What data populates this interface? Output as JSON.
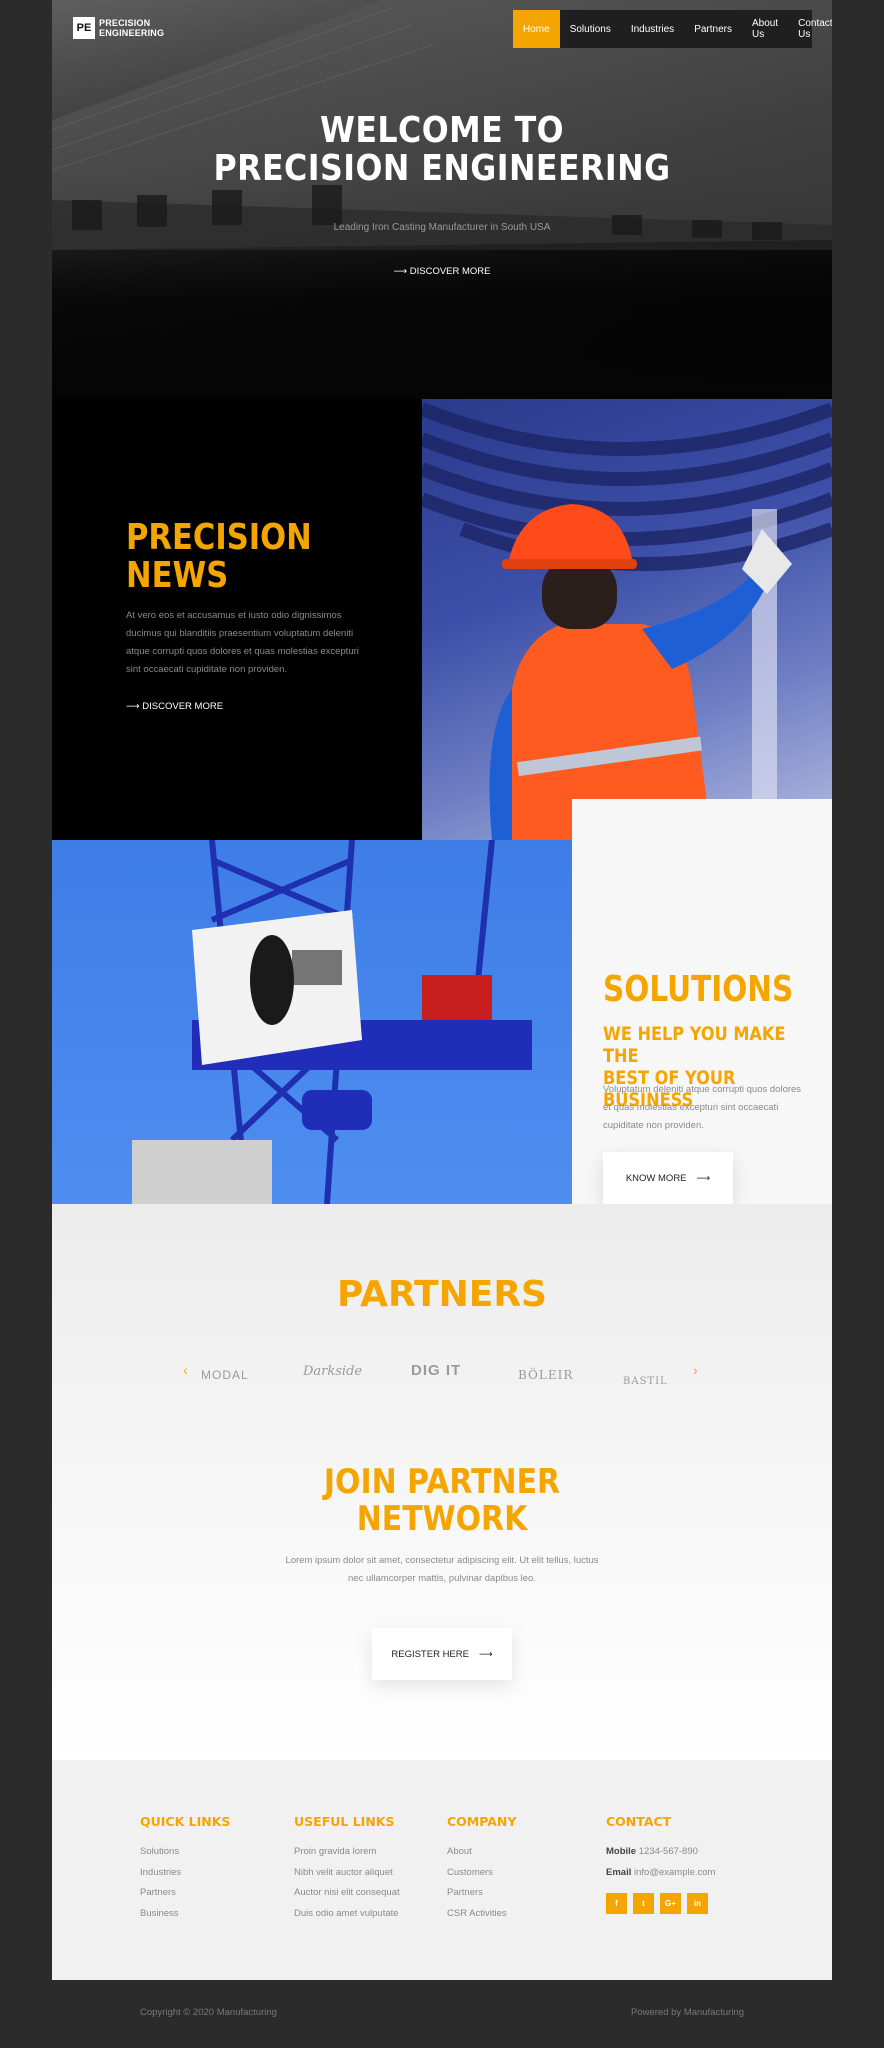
{
  "brand": {
    "logo_mark": "PE",
    "name_line1": "PRECISION",
    "name_line2": "ENGINEERING"
  },
  "nav": {
    "items": [
      "Home",
      "Solutions",
      "Industries",
      "Partners",
      "About Us",
      "Contact Us"
    ],
    "active": "Home"
  },
  "hero": {
    "title_line1": "WELCOME TO",
    "title_line2": "PRECISION ENGINEERING",
    "subtitle": "Leading Iron Casting Manufacturer in South USA",
    "cta": "DISCOVER MORE"
  },
  "news": {
    "title_line1": "PRECISION",
    "title_line2": "NEWS",
    "text": "At vero eos et accusamus et iusto odio dignissimos ducimus qui blanditiis praesentium voluptatum deleniti atque corrupti quos dolores et quas molestias excepturi sint occaecati cupiditate non providen.",
    "cta": "DISCOVER MORE"
  },
  "solutions": {
    "title": "SOLUTIONS",
    "subtitle_line1": "WE HELP YOU MAKE THE",
    "subtitle_line2": "BEST OF YOUR BUSINESS",
    "text": "Voluptatum deleniti atque corrupti quos dolores et quas molestias excepturi sint occaecati cupiditate non providen.",
    "button": "KNOW MORE"
  },
  "partners": {
    "title": "PARTNERS",
    "logos": [
      "MODAL",
      "Darkside",
      "DIG IT",
      "BÖLEIR",
      "BASTIL"
    ]
  },
  "join": {
    "title_line1": "JOIN PARTNER",
    "title_line2": "NETWORK",
    "text_line1": "Lorem ipsum dolor sit amet, consectetur adipiscing elit. Ut elit tellus, luctus",
    "text_line2": "nec ullamcorper mattis, pulvinar dapibus leo.",
    "button": "REGISTER HERE"
  },
  "footer": {
    "quick_links": {
      "title": "QUICK LINKS",
      "items": [
        "Solutions",
        "Industries",
        "Partners",
        "Business"
      ]
    },
    "useful_links": {
      "title": "USEFUL LINKS",
      "items": [
        "Proin gravida lorem",
        "Nibh velit auctor aliquet",
        "Auctor nisi elit consequat",
        "Duis odio amet vulputate"
      ]
    },
    "company": {
      "title": "COMPANY",
      "items": [
        "About",
        "Customers",
        "Partners",
        "CSR Activities"
      ]
    },
    "contact": {
      "title": "CONTACT",
      "mobile_label": "Mobile",
      "mobile": "1234-567-890",
      "email_label": "Email",
      "email": "info@example.com",
      "social": [
        "f",
        "t",
        "G+",
        "in"
      ]
    }
  },
  "copyright": "Copyright © 2020 Manufacturing",
  "powered_by": "Powered by Manufacturing",
  "colors": {
    "accent": "#f5a500",
    "dark": "#2b2b2b"
  }
}
